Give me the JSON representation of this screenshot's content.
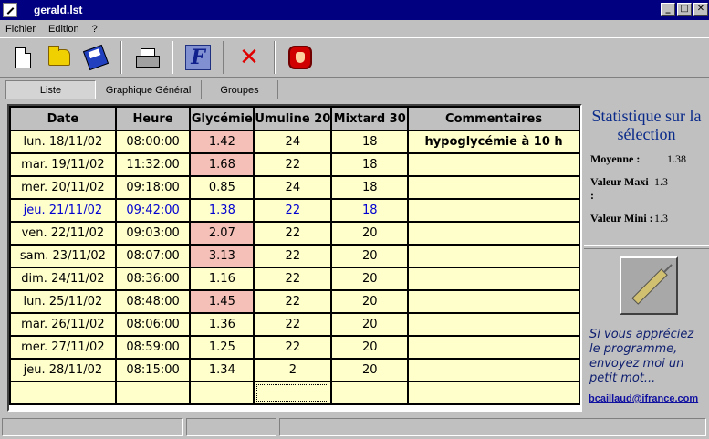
{
  "window": {
    "title": "gerald.lst"
  },
  "menu": {
    "fichier": "Fichier",
    "edition": "Edition",
    "help": "?"
  },
  "window_buttons": {
    "minimize": "_",
    "maximize": "□",
    "close": "✕"
  },
  "tabs": [
    "Liste",
    "Graphique Général",
    "Groupes"
  ],
  "table": {
    "headers": [
      "Date",
      "Heure",
      "Glycémie",
      "Umuline 20",
      "Mixtard 30",
      "Commentaires"
    ],
    "rows": [
      [
        "lun. 18/11/02",
        "08:00:00",
        "1.42",
        "24",
        "18",
        "hypoglycémie à 10 h"
      ],
      [
        "mar. 19/11/02",
        "11:32:00",
        "1.68",
        "22",
        "18",
        ""
      ],
      [
        "mer. 20/11/02",
        "09:18:00",
        "0.85",
        "24",
        "18",
        ""
      ],
      [
        "jeu. 21/11/02",
        "09:42:00",
        "1.38",
        "22",
        "18",
        ""
      ],
      [
        "ven. 22/11/02",
        "09:03:00",
        "2.07",
        "22",
        "20",
        ""
      ],
      [
        "sam. 23/11/02",
        "08:07:00",
        "3.13",
        "22",
        "20",
        ""
      ],
      [
        "dim. 24/11/02",
        "08:36:00",
        "1.16",
        "22",
        "20",
        ""
      ],
      [
        "lun. 25/11/02",
        "08:48:00",
        "1.45",
        "22",
        "20",
        ""
      ],
      [
        "mar. 26/11/02",
        "08:06:00",
        "1.36",
        "22",
        "20",
        ""
      ],
      [
        "mer. 27/11/02",
        "08:59:00",
        "1.25",
        "22",
        "20",
        ""
      ],
      [
        "jeu. 28/11/02",
        "08:15:00",
        "1.34",
        "2",
        "20",
        ""
      ],
      [
        "",
        "",
        "",
        "",
        "",
        ""
      ]
    ],
    "highlight_glycemia_rows": [
      0,
      1,
      4,
      5,
      7
    ],
    "highlight_color": "#f4c0b8",
    "cell_background": "#ffffcc",
    "selected_row_index": 3,
    "selected_row_color": "#0000d0"
  },
  "stats": {
    "title": "Statistique sur la sélection",
    "moyenne_label": "Moyenne :",
    "moyenne_value": "1.38",
    "maxi_label": "Valeur Maxi :",
    "maxi_value": "1.3",
    "mini_label": "Valeur Mini :",
    "mini_value": "1.3"
  },
  "promo": {
    "message": "Si vous appréciez le programme, envoyez moi un petit mot...",
    "email": "bcaillaud@ifrance.com"
  }
}
